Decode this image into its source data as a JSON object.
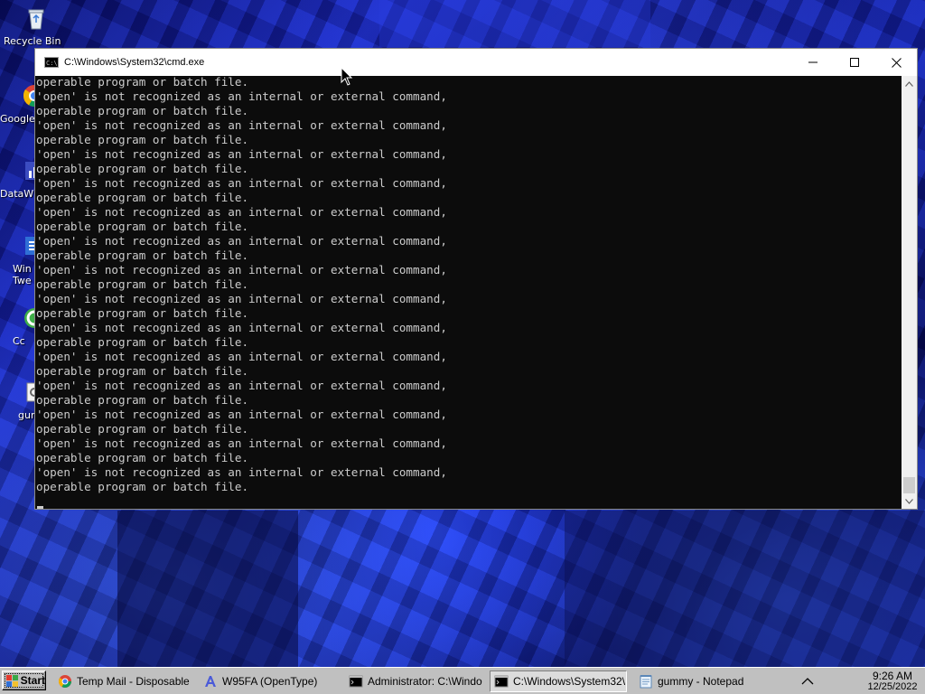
{
  "desktop": {
    "icons": [
      {
        "name": "recycle-bin",
        "label": "Recycle Bin"
      },
      {
        "name": "google-chrome",
        "label": "Google"
      },
      {
        "name": "datawrapper",
        "label": "DataW"
      },
      {
        "name": "win-tweaker",
        "label": "Win Twe"
      },
      {
        "name": "ccleaner",
        "label": "Cc"
      },
      {
        "name": "gummy",
        "label": "gum"
      }
    ]
  },
  "cmd_window": {
    "title": "C:\\Windows\\System32\\cmd.exe",
    "console_color": "#0c0c0c",
    "text_color": "#cccccc",
    "lines": [
      "operable program or batch file.",
      "'open' is not recognized as an internal or external command,",
      "operable program or batch file.",
      "'open' is not recognized as an internal or external command,",
      "operable program or batch file.",
      "'open' is not recognized as an internal or external command,",
      "operable program or batch file.",
      "'open' is not recognized as an internal or external command,",
      "operable program or batch file.",
      "'open' is not recognized as an internal or external command,",
      "operable program or batch file.",
      "'open' is not recognized as an internal or external command,",
      "operable program or batch file.",
      "'open' is not recognized as an internal or external command,",
      "operable program or batch file.",
      "'open' is not recognized as an internal or external command,",
      "operable program or batch file.",
      "'open' is not recognized as an internal or external command,",
      "operable program or batch file.",
      "'open' is not recognized as an internal or external command,",
      "operable program or batch file.",
      "'open' is not recognized as an internal or external command,",
      "operable program or batch file.",
      "'open' is not recognized as an internal or external command,",
      "operable program or batch file.",
      "'open' is not recognized as an internal or external command,",
      "operable program or batch file.",
      "'open' is not recognized as an internal or external command,",
      "operable program or batch file."
    ],
    "controls": {
      "minimize": "minimize-icon",
      "maximize": "maximize-icon",
      "close": "close-icon"
    }
  },
  "taskbar": {
    "start_label": "Start",
    "items": [
      {
        "label": "Temp Mail - Disposable ...",
        "icon": "chrome-icon",
        "active": false
      },
      {
        "label": "W95FA (OpenType)",
        "icon": "font-viewer-icon",
        "active": false
      },
      {
        "label": "Administrator: C:\\Windo...",
        "icon": "cmd-icon",
        "active": false
      },
      {
        "label": "C:\\Windows\\System32\\...",
        "icon": "cmd-icon",
        "active": true
      },
      {
        "label": "gummy - Notepad",
        "icon": "notepad-icon",
        "active": false
      }
    ],
    "clock": {
      "time": "9:26 AM",
      "date": "12/25/2022"
    }
  }
}
